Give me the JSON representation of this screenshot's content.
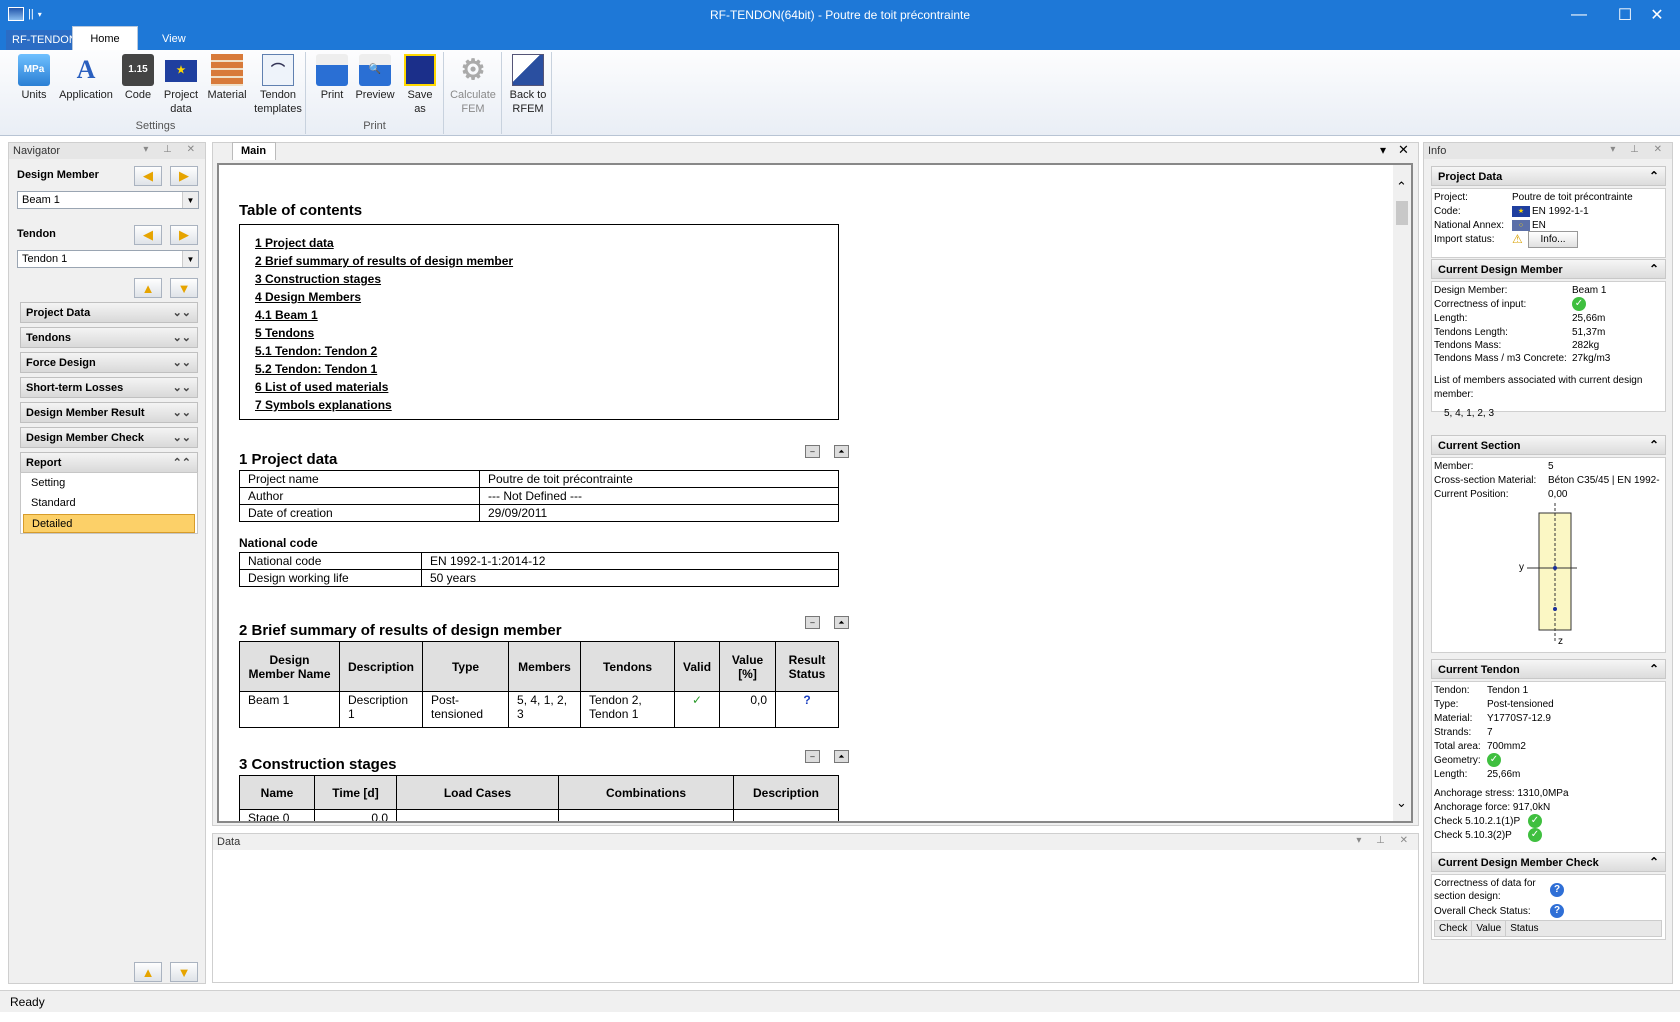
{
  "window": {
    "title": "RF-TENDON(64bit) - Poutre de toit précontrainte",
    "minimize": "—",
    "maximize": "☐",
    "close": "✕"
  },
  "tabs": {
    "file": "RF-TENDON",
    "home": "Home",
    "view": "View"
  },
  "ribbon": {
    "settings_group": "Settings",
    "print_group": "Print",
    "units": "Units",
    "application": "Application",
    "code": "Code",
    "project_data_1": "Project",
    "project_data_2": "data",
    "material": "Material",
    "tendon_templates_1": "Tendon",
    "tendon_templates_2": "templates",
    "print": "Print",
    "preview": "Preview",
    "save_as_1": "Save",
    "save_as_2": "as",
    "calculate_1": "Calculate",
    "calculate_2": "FEM",
    "back_1": "Back to",
    "back_2": "RFEM",
    "units_icon_text": "MPa",
    "code_icon_text": "1.15"
  },
  "navigator": {
    "title": "Navigator",
    "design_member_label": "Design Member",
    "design_member_value": "Beam 1",
    "tendon_label": "Tendon",
    "tendon_value": "Tendon 1",
    "sections": [
      "Project Data",
      "Tendons",
      "Force Design",
      "Short-term Losses",
      "Design Member Result",
      "Design Member Check",
      "Report"
    ],
    "report_items": [
      "Setting",
      "Standard",
      "Detailed"
    ]
  },
  "main": {
    "tab": "Main",
    "toc_title": "Table of contents",
    "toc": [
      "1 Project data",
      "2 Brief summary of results of design member",
      "3 Construction stages",
      "4 Design Members",
      "4.1 Beam 1",
      "5 Tendons",
      "5.1 Tendon: Tendon 2",
      "5.2 Tendon: Tendon 1",
      "6 List of used materials",
      "7 Symbols explanations"
    ],
    "s1_title": "1 Project data",
    "project_rows": [
      [
        "Project name",
        "Poutre de toit précontrainte"
      ],
      [
        "Author",
        "--- Not Defined ---"
      ],
      [
        "Date of creation",
        "29/09/2011"
      ]
    ],
    "national_code_title": "National code",
    "national_rows": [
      [
        "National code",
        "EN 1992-1-1:2014-12"
      ],
      [
        "Design working life",
        "50 years"
      ]
    ],
    "s2_title": "2 Brief summary of results of design member",
    "s2_headers": [
      "Design Member Name",
      "Description",
      "Type",
      "Members",
      "Tendons",
      "Valid",
      "Value [%]",
      "Result Status"
    ],
    "s2_row": [
      "Beam 1",
      "Description 1",
      "Post-tensioned",
      "5, 4, 1, 2, 3",
      "Tendon 2, Tendon 1",
      "✓",
      "0,0",
      "?"
    ],
    "s3_title": "3 Construction stages",
    "s3_headers": [
      "Name",
      "Time [d]",
      "Load Cases",
      "Combinations",
      "Description"
    ],
    "s3_row": [
      "Stage 0",
      "0,0",
      "",
      "",
      ""
    ]
  },
  "data_panel": {
    "title": "Data"
  },
  "info": {
    "title": "Info",
    "project_data": {
      "title": "Project Data",
      "project_label": "Project:",
      "project": "Poutre de toit précontrainte",
      "code_label": "Code:",
      "code": "EN 1992-1-1",
      "annex_label": "National Annex:",
      "annex": "EN",
      "import_label": "Import status:",
      "info_button": "Info..."
    },
    "design_member": {
      "title": "Current Design Member",
      "rows": [
        [
          "Design Member:",
          "Beam 1"
        ],
        [
          "Correctness of input:",
          ""
        ],
        [
          "Length:",
          "25,66m"
        ],
        [
          "Tendons Length:",
          "51,37m"
        ],
        [
          "Tendons Mass:",
          "282kg"
        ],
        [
          "Tendons Mass / m3 Concrete:",
          "27kg/m3"
        ]
      ],
      "list_label": "List of members associated with current design member:",
      "list": "5, 4, 1, 2, 3"
    },
    "section": {
      "title": "Current Section",
      "member_label": "Member:",
      "member": "5",
      "material_label": "Cross-section Material:",
      "material": "Béton C35/45 | EN 1992-",
      "position_label": "Current Position:",
      "position": "0,00",
      "axis_y": "y",
      "axis_z": "z"
    },
    "tendon": {
      "title": "Current Tendon",
      "rows": [
        [
          "Tendon:",
          "Tendon 1"
        ],
        [
          "Type:",
          "Post-tensioned"
        ],
        [
          "Material:",
          "Y1770S7-12.9"
        ],
        [
          "Strands:",
          "7"
        ],
        [
          "Total area:",
          "700mm2"
        ],
        [
          "Geometry:",
          ""
        ],
        [
          "Length:",
          "25,66m"
        ]
      ],
      "anch_stress": "Anchorage stress: 1310,0MPa",
      "anch_force": "Anchorage force:  917,0kN",
      "check1": "Check 5.10.2.1(1)P",
      "check2": "Check 5.10.3(2)P"
    },
    "check": {
      "title": "Current Design Member Check",
      "correct_1": "Correctness of data for",
      "correct_2": "section design:",
      "overall": "Overall Check Status:",
      "cols": [
        "Check",
        "Value",
        "Status"
      ]
    }
  },
  "status": {
    "text": "Ready"
  }
}
